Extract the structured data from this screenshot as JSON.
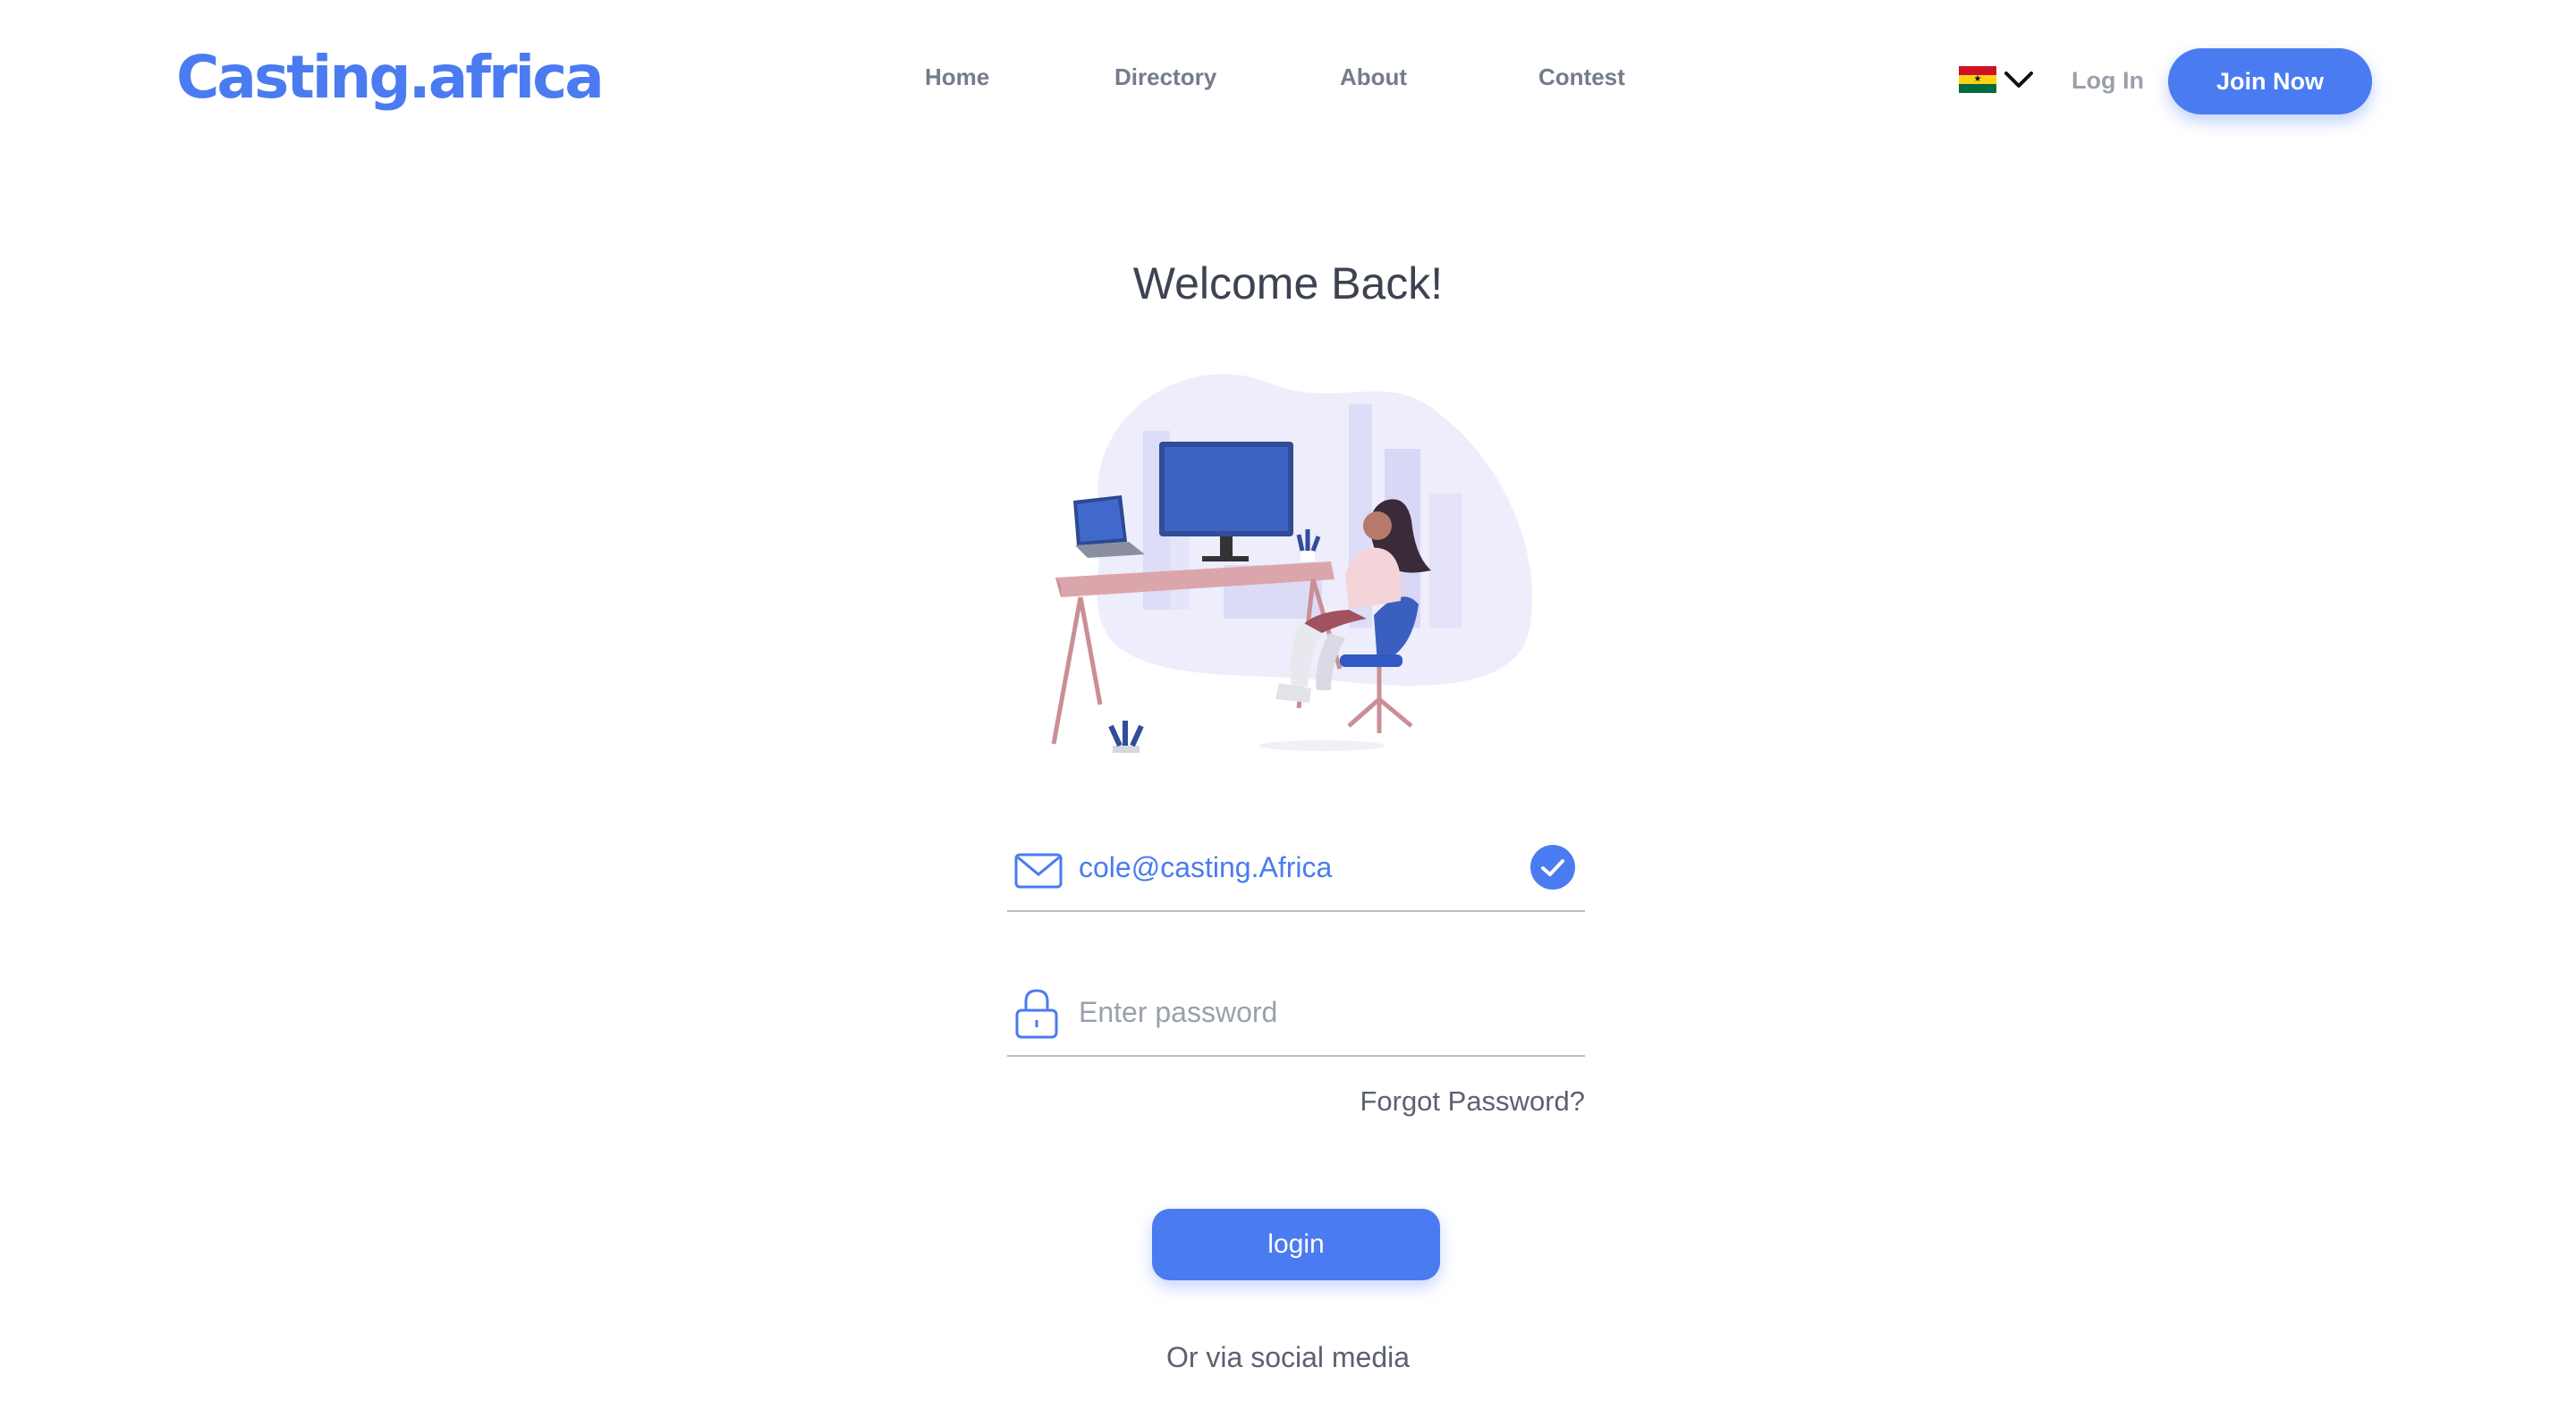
{
  "header": {
    "logo": "Casting.africa",
    "nav": [
      "Home",
      "Directory",
      "About",
      "Contest"
    ],
    "language_flag": "ghana-flag",
    "login_label": "Log In",
    "join_label": "Join Now"
  },
  "main": {
    "title": "Welcome Back!",
    "email": {
      "value": "cole@casting.Africa",
      "icon": "envelope-icon",
      "status": "valid"
    },
    "password": {
      "placeholder": "Enter password",
      "icon": "lock-icon"
    },
    "forgot_label": "Forgot Password?",
    "login_button": "login",
    "social_text": "Or via social media"
  },
  "colors": {
    "accent": "#4a7bf0",
    "nav_text": "#747c8c",
    "body_text": "#3d4352",
    "divider": "#b9bec8"
  }
}
